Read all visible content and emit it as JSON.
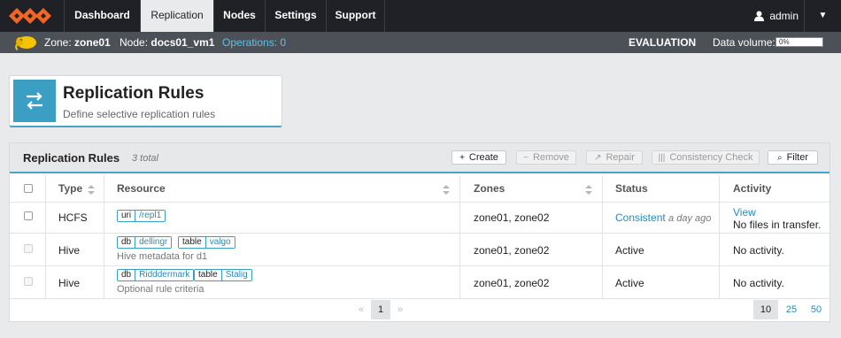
{
  "nav": {
    "tabs": [
      "Dashboard",
      "Replication",
      "Nodes",
      "Settings",
      "Support"
    ],
    "active": "Replication",
    "user": "admin",
    "logo_icon": "wandisco-logo-icon",
    "user_icon": "user-icon",
    "menu_icon": "caret-down-icon"
  },
  "status_bar": {
    "zone_label": "Zone:",
    "zone": "zone01",
    "node_label": "Node:",
    "node": "docs01_vm1",
    "operations": "Operations: 0",
    "license": "EVALUATION",
    "volume_label": "Data volume:",
    "volume_value": "0%",
    "volume_fraction": 0
  },
  "header": {
    "title": "Replication Rules",
    "subtitle": "Define selective replication rules",
    "icon": "swap-arrows-icon"
  },
  "panel": {
    "title": "Replication Rules",
    "count": "3 total",
    "buttons": [
      {
        "label": "Create",
        "icon": "+",
        "enabled": true
      },
      {
        "label": "Remove",
        "icon": "−",
        "enabled": false
      },
      {
        "label": "Repair",
        "icon": "↗",
        "enabled": false
      },
      {
        "label": "Consistency Check",
        "icon": "|||",
        "enabled": false
      },
      {
        "label": "Filter",
        "icon": "⌕",
        "enabled": true
      }
    ],
    "columns": [
      "Type",
      "Resource",
      "Zones",
      "Status",
      "Activity"
    ],
    "rows": [
      {
        "type": "HCFS",
        "tags": [
          {
            "k": "uri",
            "v": "/repl1"
          }
        ],
        "desc": "",
        "zones": "zone01, zone02",
        "status": "Consistent",
        "status_time": "a day ago",
        "activity_link": "View",
        "activity": "No files in transfer."
      },
      {
        "type": "Hive",
        "tags": [
          {
            "k": "db",
            "v": "dellingr"
          },
          {
            "k": "table",
            "v": "valgo"
          }
        ],
        "desc": "Hive metadata for d1",
        "zones": "zone01, zone02",
        "status": "Active",
        "status_time": "",
        "activity_link": "",
        "activity": "No activity."
      },
      {
        "type": "Hive",
        "tags": [
          {
            "k": "db",
            "v": "Ridddermark"
          },
          {
            "k": "table",
            "v": "Stalig"
          }
        ],
        "desc": "Optional rule criteria",
        "zones": "zone01, zone02",
        "status": "Active",
        "status_time": "",
        "activity_link": "",
        "activity": "No activity."
      }
    ],
    "pagination": {
      "prev": "«",
      "page": "1",
      "next": "»"
    },
    "page_sizes": [
      "10",
      "25",
      "50"
    ],
    "page_size_selected": "10"
  },
  "colors": {
    "accent": "#3a9fc3",
    "nav_bg": "#1f2126",
    "logo": "#f26522"
  }
}
